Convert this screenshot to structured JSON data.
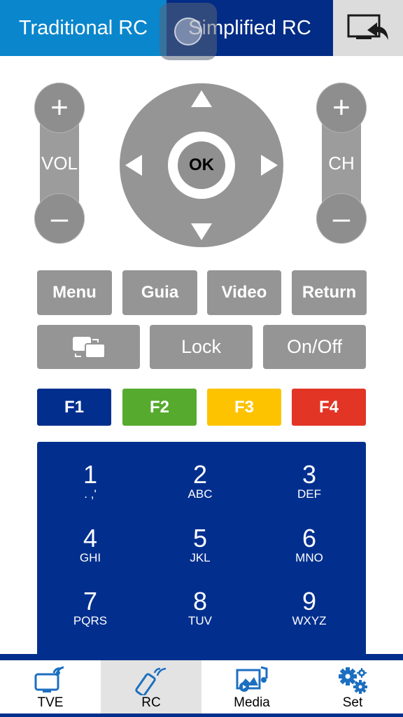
{
  "header": {
    "tab_traditional": "Traditional RC",
    "tab_simplified": "Simplified RC",
    "cast_icon": "screen-mirror-icon"
  },
  "volume": {
    "plus": "+",
    "minus": "–",
    "label": "VOL"
  },
  "channel": {
    "plus": "+",
    "minus": "–",
    "label": "CH"
  },
  "dpad": {
    "ok": "OK"
  },
  "row1": [
    "Menu",
    "Guia",
    "Video",
    "Return"
  ],
  "row2": {
    "switch_icon": "input-switch-icon",
    "lock": "Lock",
    "power": "On/Off"
  },
  "fkeys": [
    {
      "label": "F1",
      "color": "#022f8e"
    },
    {
      "label": "F2",
      "color": "#56ab2f"
    },
    {
      "label": "F3",
      "color": "#fdc300"
    },
    {
      "label": "F4",
      "color": "#e23526"
    }
  ],
  "keypad": [
    {
      "num": "1",
      "sub": ". ,'"
    },
    {
      "num": "2",
      "sub": "ABC"
    },
    {
      "num": "3",
      "sub": "DEF"
    },
    {
      "num": "4",
      "sub": "GHI"
    },
    {
      "num": "5",
      "sub": "JKL"
    },
    {
      "num": "6",
      "sub": "MNO"
    },
    {
      "num": "7",
      "sub": "PQRS"
    },
    {
      "num": "8",
      "sub": "TUV"
    },
    {
      "num": "9",
      "sub": "WXYZ"
    }
  ],
  "nav": [
    {
      "label": "TVE",
      "icon": "tv-wireless-icon"
    },
    {
      "label": "RC",
      "icon": "remote-control-icon",
      "active": true
    },
    {
      "label": "Media",
      "icon": "media-gallery-icon"
    },
    {
      "label": "Set",
      "icon": "settings-gears-icon"
    }
  ],
  "colors": {
    "accent_blue": "#0a86cc",
    "dark_blue": "#022c86",
    "button_gray": "#959595"
  }
}
